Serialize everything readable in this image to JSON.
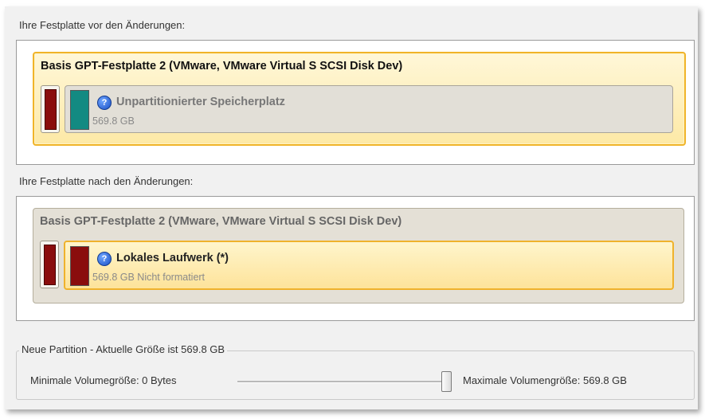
{
  "before": {
    "section_label": "Ihre Festplatte vor den Änderungen:",
    "disk_title": "Basis GPT-Festplatte 2 (VMware, VMware Virtual S SCSI Disk Dev)",
    "partition": {
      "name": "Unpartitionierter Speicherplatz",
      "size": "569.8 GB",
      "swatch_color": "#138a82"
    }
  },
  "after": {
    "section_label": "Ihre Festplatte nach den Änderungen:",
    "disk_title": "Basis GPT-Festplatte 2 (VMware, VMware Virtual S SCSI Disk Dev)",
    "partition": {
      "name": "Lokales Laufwerk (*)",
      "size": "569.8 GB Nicht formatiert",
      "swatch_color": "#8a0d0d"
    }
  },
  "new_partition": {
    "legend": "Neue Partition - Aktuelle Größe ist 569.8 GB",
    "min_label": "Minimale Volumegröße:  0 Bytes",
    "max_label": "Maximale Volumengröße:  569.8 GB",
    "slider_value_fraction": 1.0
  },
  "colors": {
    "selected_border": "#f0b429",
    "gpt_block": "#8a0d0d"
  }
}
